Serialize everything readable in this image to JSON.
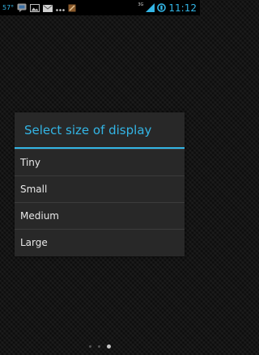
{
  "status_bar": {
    "temperature": "57°",
    "network": "3G",
    "time": "11:12",
    "icons": [
      "hangouts-icon",
      "gallery-icon",
      "gmail-icon",
      "dots-icon",
      "tool-icon",
      "signal-icon",
      "battery-icon"
    ],
    "accent": "#33b5e5"
  },
  "dialog": {
    "title": "Select size of display",
    "options": [
      "Tiny",
      "Small",
      "Medium",
      "Large"
    ]
  },
  "page_indicator": {
    "count": 3,
    "active_index": 2
  }
}
